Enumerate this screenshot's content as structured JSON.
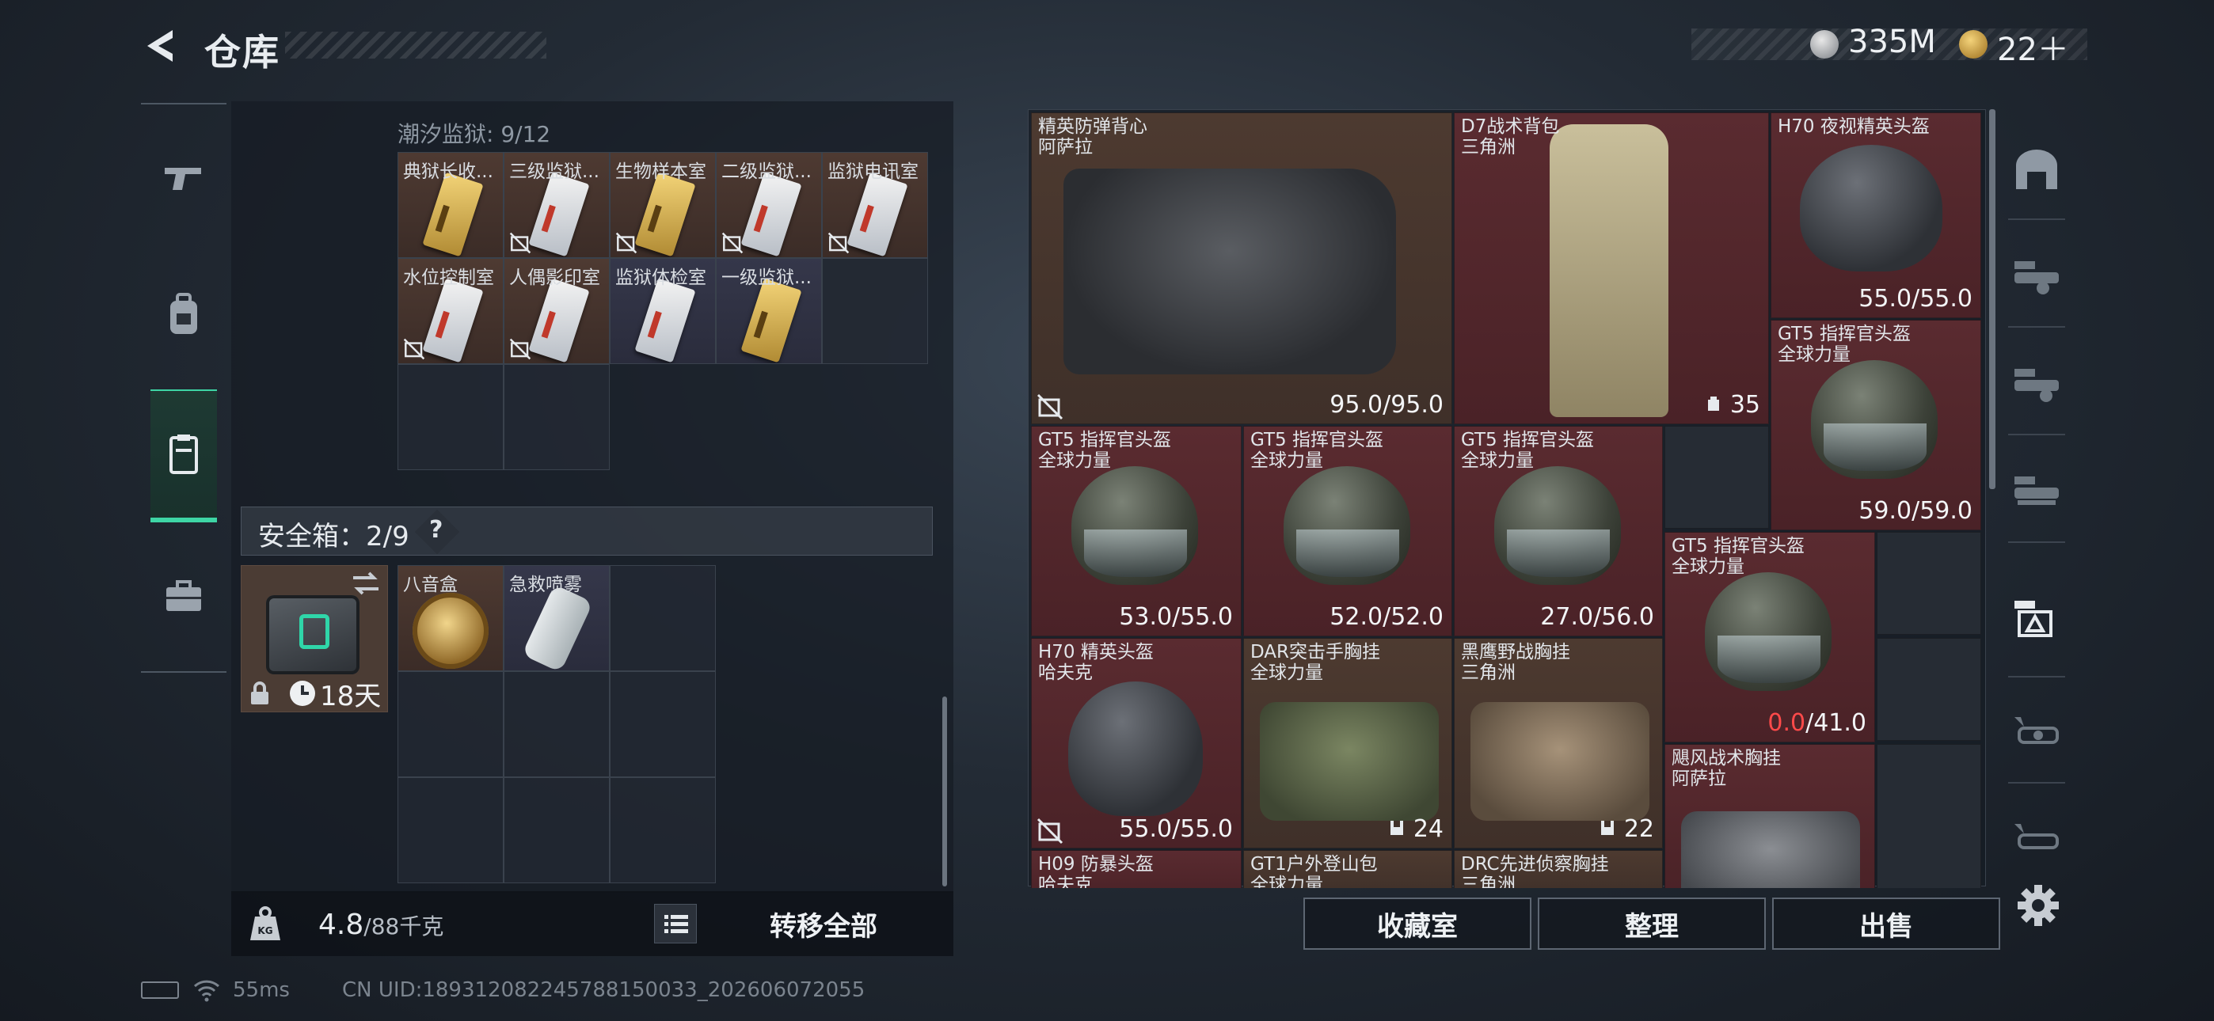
{
  "header": {
    "title": "仓库",
    "currency_silver": "335M",
    "currency_gold": "22＋"
  },
  "storage": {
    "section_title": "潮汐监狱: 9/12",
    "keys": [
      {
        "name": "典狱长收...",
        "style": "brown",
        "card": "gold",
        "bound": false
      },
      {
        "name": "三级监狱...",
        "style": "brown",
        "card": "white",
        "bound": true
      },
      {
        "name": "生物样本室",
        "style": "brown",
        "card": "gold",
        "bound": true
      },
      {
        "name": "二级监狱...",
        "style": "brown",
        "card": "white",
        "bound": true
      },
      {
        "name": "监狱电讯室",
        "style": "brown",
        "card": "white",
        "bound": true
      },
      {
        "name": "水位控制室",
        "style": "brown",
        "card": "white",
        "bound": true
      },
      {
        "name": "人偶影印室",
        "style": "brown",
        "card": "white",
        "bound": true
      },
      {
        "name": "监狱体检室",
        "style": "blue",
        "card": "white",
        "bound": false
      },
      {
        "name": "一级监狱...",
        "style": "blue",
        "card": "gold",
        "bound": false
      }
    ]
  },
  "safebox": {
    "title": "安全箱：2/9",
    "help": "?",
    "duration": "18天",
    "items": [
      {
        "name": "八音盒"
      },
      {
        "name": "急救喷雾"
      }
    ]
  },
  "weight": {
    "current": "4.8",
    "max": "/88千克"
  },
  "transfer_all": "转移全部",
  "inventory": {
    "vest": {
      "name": "精英防弹背心",
      "sub": "阿萨拉",
      "durability": "95.0/95.0"
    },
    "backpack": {
      "name": "D7战术背包",
      "sub": "三角洲",
      "count": "35"
    },
    "h70_night": {
      "name": "H70 夜视精英头盔",
      "durability": "55.0/55.0"
    },
    "gt5_a": {
      "name": "GT5 指挥官头盔",
      "sub": "全球力量",
      "durability": "59.0/59.0"
    },
    "gt5_b": {
      "name": "GT5 指挥官头盔",
      "sub": "全球力量",
      "durability": "53.0/55.0"
    },
    "gt5_c": {
      "name": "GT5 指挥官头盔",
      "sub": "全球力量",
      "durability": "52.0/52.0"
    },
    "gt5_d": {
      "name": "GT5 指挥官头盔",
      "sub": "全球力量",
      "durability": "27.0/56.0"
    },
    "gt5_e": {
      "name": "GT5 指挥官头盔",
      "sub": "全球力量",
      "dur_current": "0.0",
      "dur_max": "/41.0"
    },
    "h70_elite": {
      "name": "H70 精英头盔",
      "sub": "哈夫克",
      "durability": "55.0/55.0"
    },
    "dar_rig": {
      "name": "DAR突击手胸挂",
      "sub": "全球力量",
      "count": "24"
    },
    "blackhawk_rig": {
      "name": "黑鹰野战胸挂",
      "sub": "三角洲",
      "count": "22"
    },
    "storm_rig": {
      "name": "飓风战术胸挂",
      "sub": "阿萨拉"
    },
    "h09": {
      "name": "H09 防暴头盔",
      "sub": "哈夫克"
    },
    "gt1_pack": {
      "name": "GT1户外登山包",
      "sub": "全球力量"
    },
    "drc_rig": {
      "name": "DRC先进侦察胸挂",
      "sub": "三角洲"
    }
  },
  "actions": {
    "collection": "收藏室",
    "organize": "整理",
    "sell": "出售"
  },
  "status": {
    "ping": "55ms",
    "uid": "CN UID:189312082245788150033_202606072055"
  },
  "colors": {
    "accent": "#3ed5a5",
    "slot_red": "#5a2b30",
    "slot_brown": "#4d3a30",
    "durability_low": "#ff4a4a"
  }
}
